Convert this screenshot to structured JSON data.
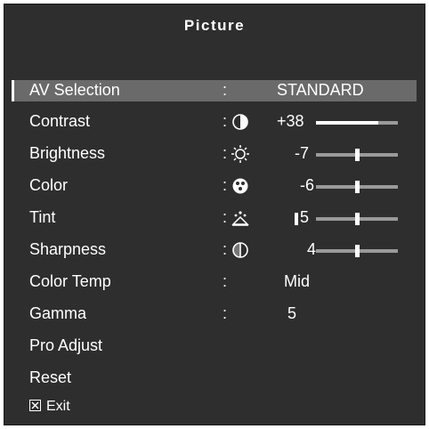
{
  "menu": {
    "title": "Picture",
    "items": [
      {
        "label": "AV Selection",
        "value": "STANDARD"
      },
      {
        "label": "Contrast",
        "value": "+38",
        "level": 0.76
      },
      {
        "label": "Brightness",
        "value": "-7",
        "level": 0.5
      },
      {
        "label": "Color",
        "value": "-6",
        "level": 0.5
      },
      {
        "label": "Tint",
        "value": "5",
        "level": 0.5
      },
      {
        "label": "Sharpness",
        "value": "4",
        "level": 0.5
      },
      {
        "label": "Color Temp",
        "value": "Mid"
      },
      {
        "label": "Gamma",
        "value": "5"
      },
      {
        "label": "Pro Adjust"
      },
      {
        "label": "Reset"
      }
    ],
    "colon": ":",
    "exit_label": "Exit"
  },
  "icons": [
    "contrast-icon",
    "brightness-icon",
    "color-icon",
    "tint-icon",
    "sharpness-icon",
    "close-box-icon"
  ]
}
